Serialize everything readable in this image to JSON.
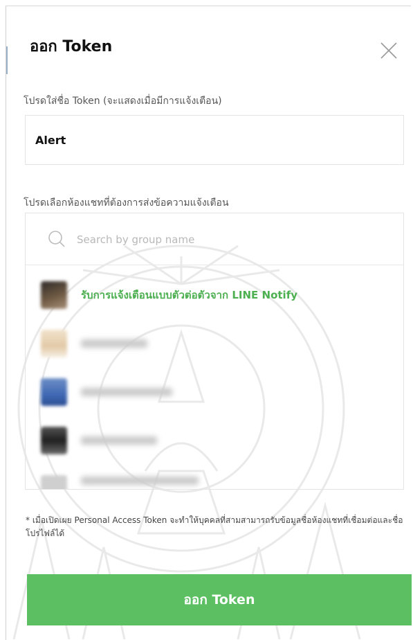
{
  "dialog": {
    "title": "ออก Token",
    "close_icon": "close-icon"
  },
  "token_name": {
    "label": "โปรดใส่ชื่อ Token (จะแสดงเมื่อมีการแจ้งเตือน)",
    "value": "Alert"
  },
  "chat_select": {
    "label": "โปรดเลือกห้องแชทที่ต้องการส่งข้อความแจ้งเตือน",
    "search_placeholder": "Search by group name",
    "search_icon": "search-icon",
    "items": [
      {
        "label": "รับการแจ้งเตือนแบบตัวต่อตัวจาก LINE Notify",
        "avatar_color": "#6e5a44"
      },
      {
        "label": "",
        "avatar_color": "#e2c9a6"
      },
      {
        "label": "",
        "avatar_color": "#3f68b3"
      },
      {
        "label": "",
        "avatar_color": "#2a2a2a"
      },
      {
        "label": "",
        "avatar_color": "#cfcfcf"
      }
    ]
  },
  "note": "* เมื่อเปิดเผย Personal Access Token จะทำให้บุคคลที่สามสามารถรับข้อมูลชื่อห้องแชทที่เชื่อมต่อและชื่อโปรไฟล์ได้",
  "issue_button": {
    "label": "ออก Token"
  },
  "colors": {
    "accent_green": "#5cc063",
    "highlight_text": "#4caf50"
  }
}
